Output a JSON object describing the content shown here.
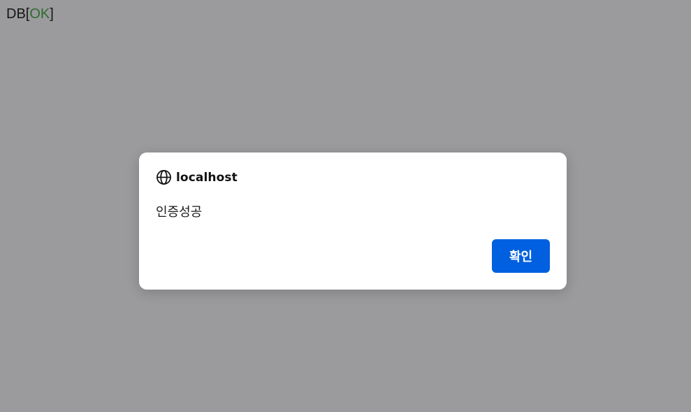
{
  "page": {
    "status_prefix": "DB[",
    "status_ok": "OK",
    "status_suffix": "]",
    "status_ok_color": "#2f6b2f"
  },
  "dialog": {
    "icon": "globe-icon",
    "origin": "localhost",
    "message": "인증성공",
    "confirm_label": "확인",
    "confirm_color": "#0060df"
  }
}
